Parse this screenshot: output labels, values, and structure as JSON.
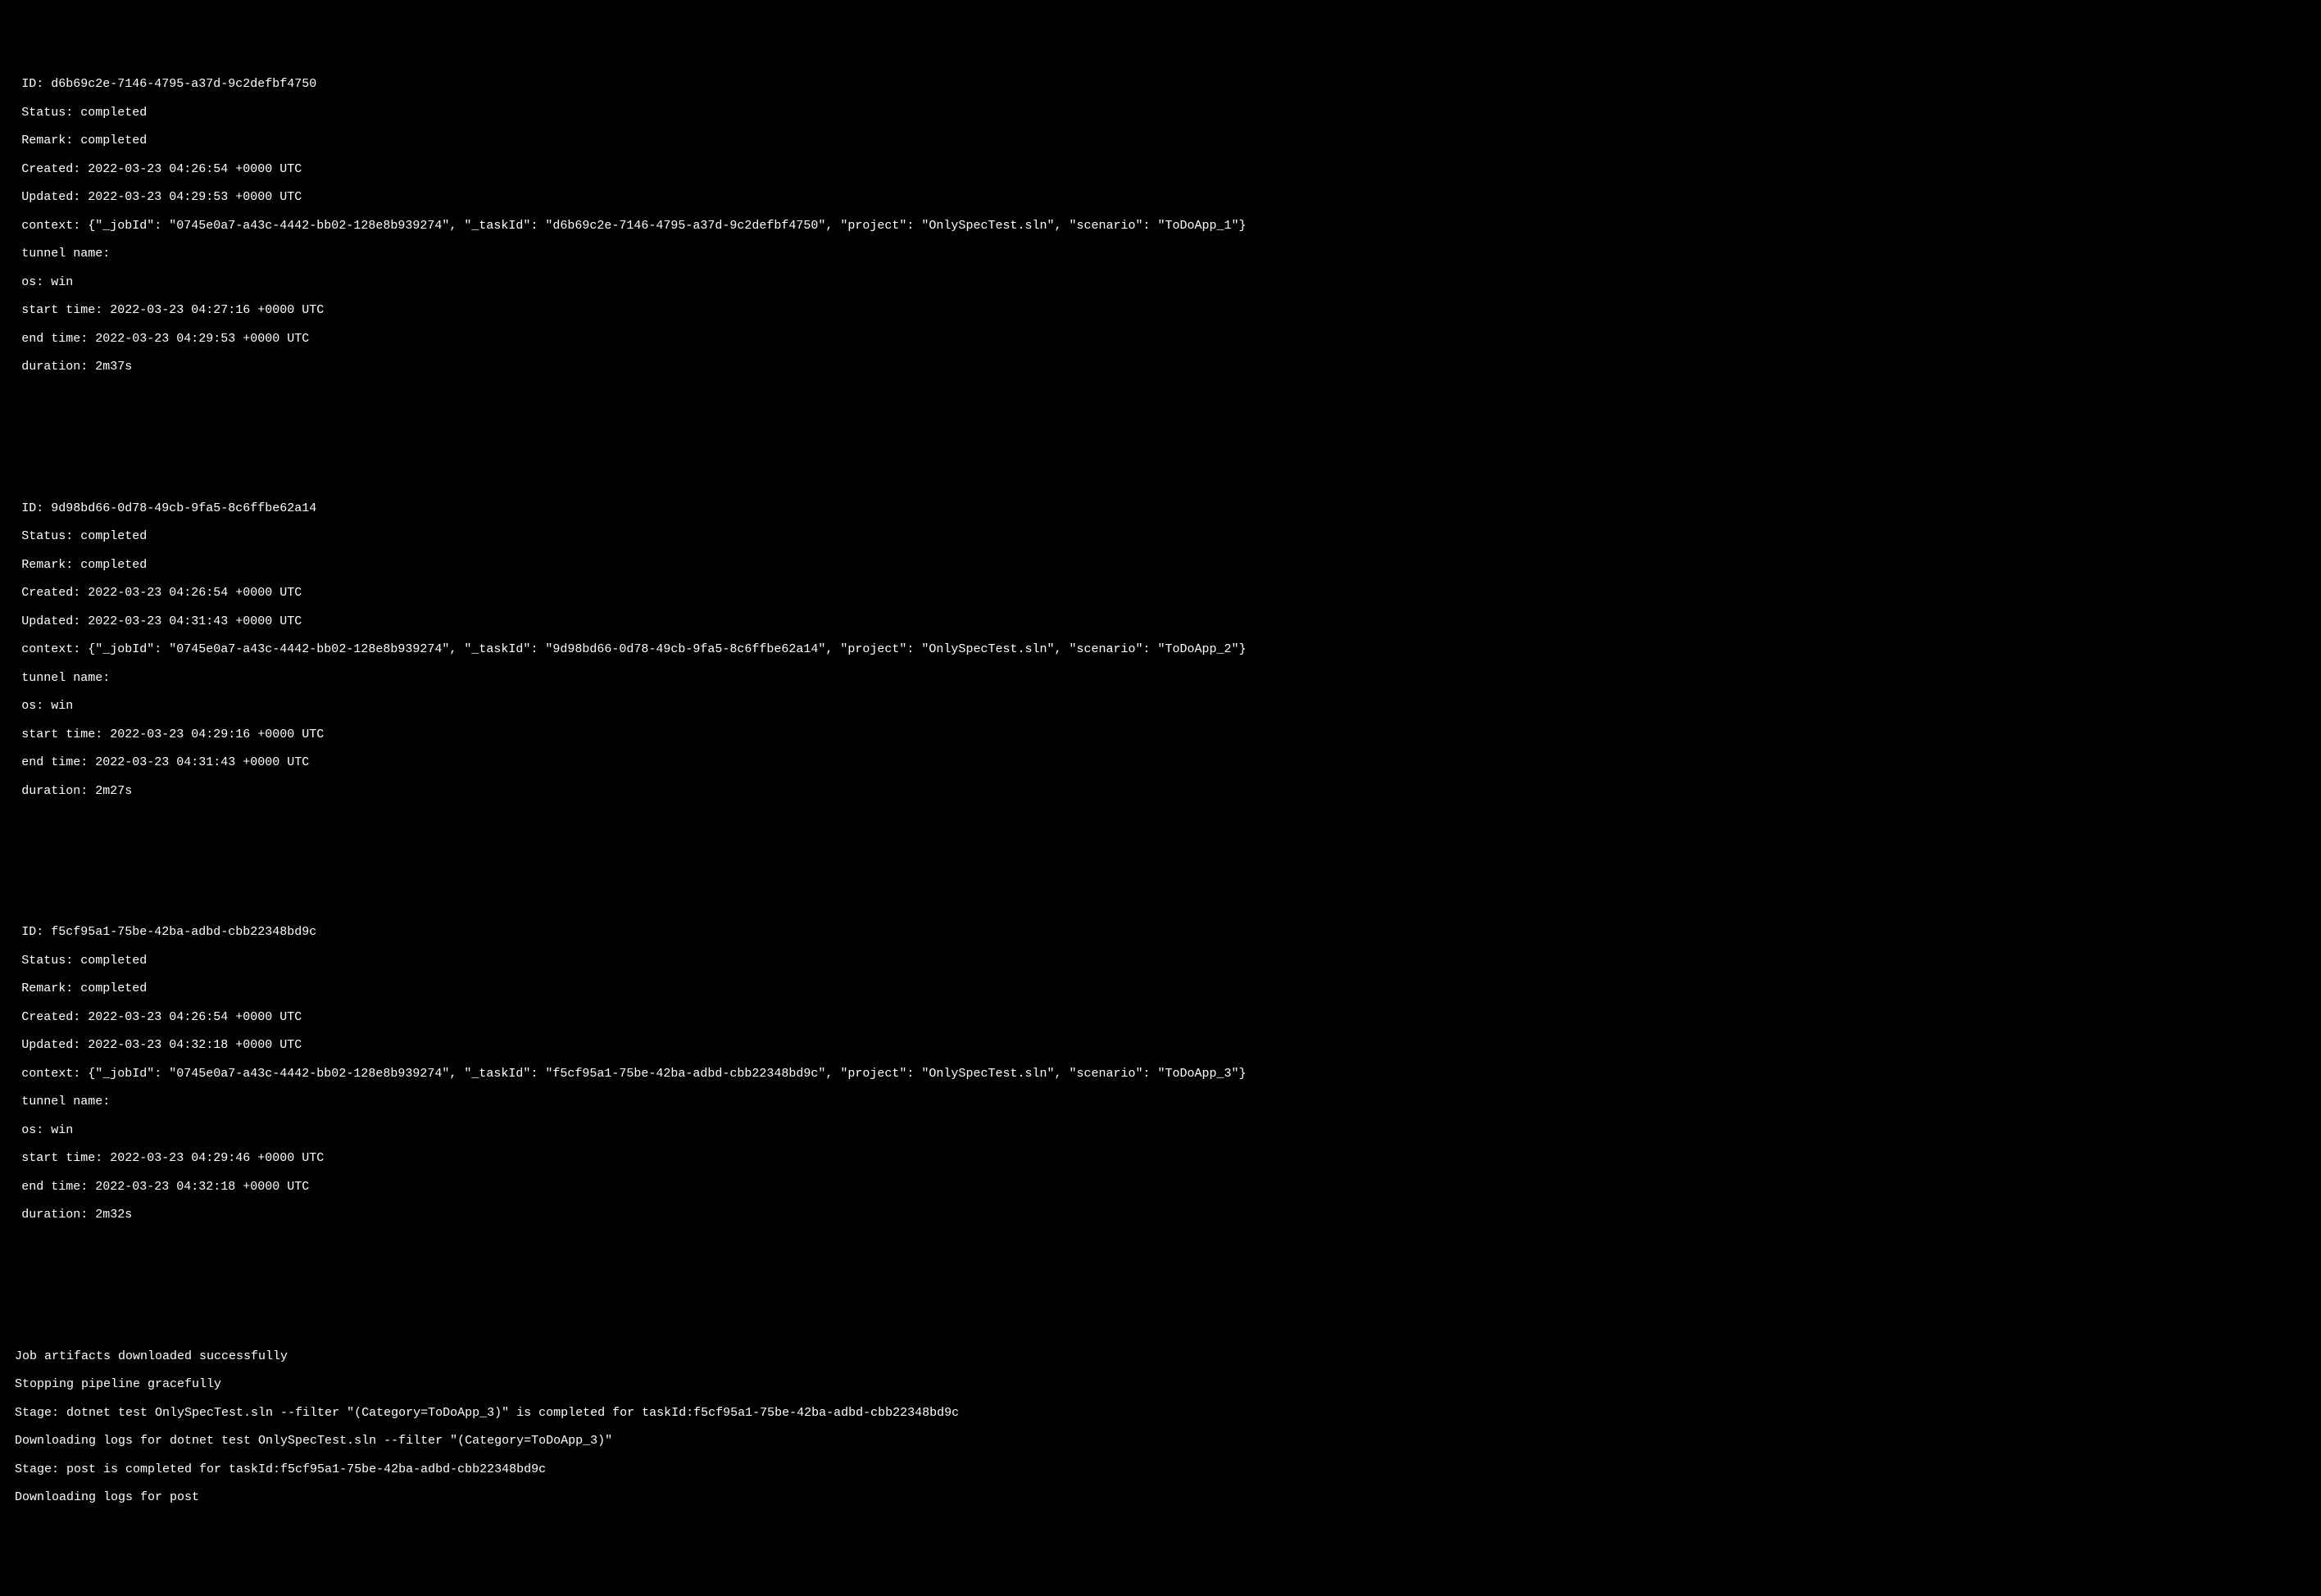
{
  "tasks": [
    {
      "id_line": "ID: d6b69c2e-7146-4795-a37d-9c2defbf4750",
      "status_line": "Status: completed",
      "remark_line": "Remark: completed",
      "created_line": "Created: 2022-03-23 04:26:54 +0000 UTC",
      "updated_line": "Updated: 2022-03-23 04:29:53 +0000 UTC",
      "context_line": "context: {\"_jobId\": \"0745e0a7-a43c-4442-bb02-128e8b939274\", \"_taskId\": \"d6b69c2e-7146-4795-a37d-9c2defbf4750\", \"project\": \"OnlySpecTest.sln\", \"scenario\": \"ToDoApp_1\"}",
      "tunnel_line": "tunnel name:",
      "os_line": "os: win",
      "start_line": "start time: 2022-03-23 04:27:16 +0000 UTC",
      "end_line": "end time: 2022-03-23 04:29:53 +0000 UTC",
      "duration_line": "duration: 2m37s"
    },
    {
      "id_line": "ID: 9d98bd66-0d78-49cb-9fa5-8c6ffbe62a14",
      "status_line": "Status: completed",
      "remark_line": "Remark: completed",
      "created_line": "Created: 2022-03-23 04:26:54 +0000 UTC",
      "updated_line": "Updated: 2022-03-23 04:31:43 +0000 UTC",
      "context_line": "context: {\"_jobId\": \"0745e0a7-a43c-4442-bb02-128e8b939274\", \"_taskId\": \"9d98bd66-0d78-49cb-9fa5-8c6ffbe62a14\", \"project\": \"OnlySpecTest.sln\", \"scenario\": \"ToDoApp_2\"}",
      "tunnel_line": "tunnel name:",
      "os_line": "os: win",
      "start_line": "start time: 2022-03-23 04:29:16 +0000 UTC",
      "end_line": "end time: 2022-03-23 04:31:43 +0000 UTC",
      "duration_line": "duration: 2m27s"
    },
    {
      "id_line": "ID: f5cf95a1-75be-42ba-adbd-cbb22348bd9c",
      "status_line": "Status: completed",
      "remark_line": "Remark: completed",
      "created_line": "Created: 2022-03-23 04:26:54 +0000 UTC",
      "updated_line": "Updated: 2022-03-23 04:32:18 +0000 UTC",
      "context_line": "context: {\"_jobId\": \"0745e0a7-a43c-4442-bb02-128e8b939274\", \"_taskId\": \"f5cf95a1-75be-42ba-adbd-cbb22348bd9c\", \"project\": \"OnlySpecTest.sln\", \"scenario\": \"ToDoApp_3\"}",
      "tunnel_line": "tunnel name:",
      "os_line": "os: win",
      "start_line": "start time: 2022-03-23 04:29:46 +0000 UTC",
      "end_line": "end time: 2022-03-23 04:32:18 +0000 UTC",
      "duration_line": "duration: 2m32s"
    }
  ],
  "footer": {
    "line1": "Job artifacts downloaded successfully",
    "line2": "Stopping pipeline gracefully",
    "line3": "Stage: dotnet test OnlySpecTest.sln --filter \"(Category=ToDoApp_3)\" is completed for taskId:f5cf95a1-75be-42ba-adbd-cbb22348bd9c",
    "line4": "Downloading logs for dotnet test OnlySpecTest.sln --filter \"(Category=ToDoApp_3)\"",
    "line5": "Stage: post is completed for taskId:f5cf95a1-75be-42ba-adbd-cbb22348bd9c",
    "line6": "Downloading logs for post"
  }
}
